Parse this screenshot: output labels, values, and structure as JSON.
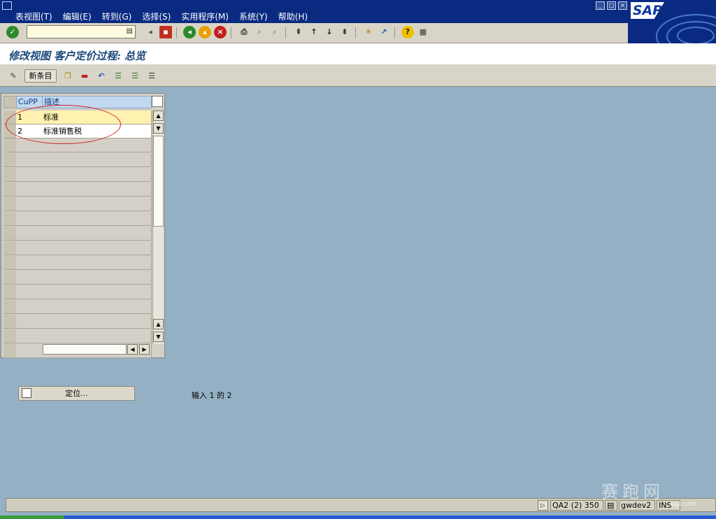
{
  "menu": {
    "items": [
      "表视图(T)",
      "编辑(E)",
      "转到(G)",
      "选择(S)",
      "实用程序(M)",
      "系统(Y)",
      "帮助(H)"
    ]
  },
  "brand": {
    "logo_text": "SAP"
  },
  "title": "修改视图 客户定价过程: 总览",
  "app_toolbar": {
    "new_entries": "新条目"
  },
  "table": {
    "columns": [
      "CuPP",
      "描述"
    ],
    "rows": [
      {
        "code": "1",
        "desc": "标准"
      },
      {
        "code": "2",
        "desc": "标准销售税"
      }
    ]
  },
  "position_button": "定位...",
  "entry_count": "输入 1 的 2",
  "status": {
    "system": "QA2 (2) 350",
    "server": "gwdev2",
    "mode": "INS"
  },
  "watermark": {
    "text": "赛跑网",
    "url": "sap.com"
  },
  "colors": {
    "menubar": "#0a2a82",
    "workspace": "#94b0c4",
    "row_filled": "#fff1b0",
    "highlight_circle": "#d42020"
  }
}
